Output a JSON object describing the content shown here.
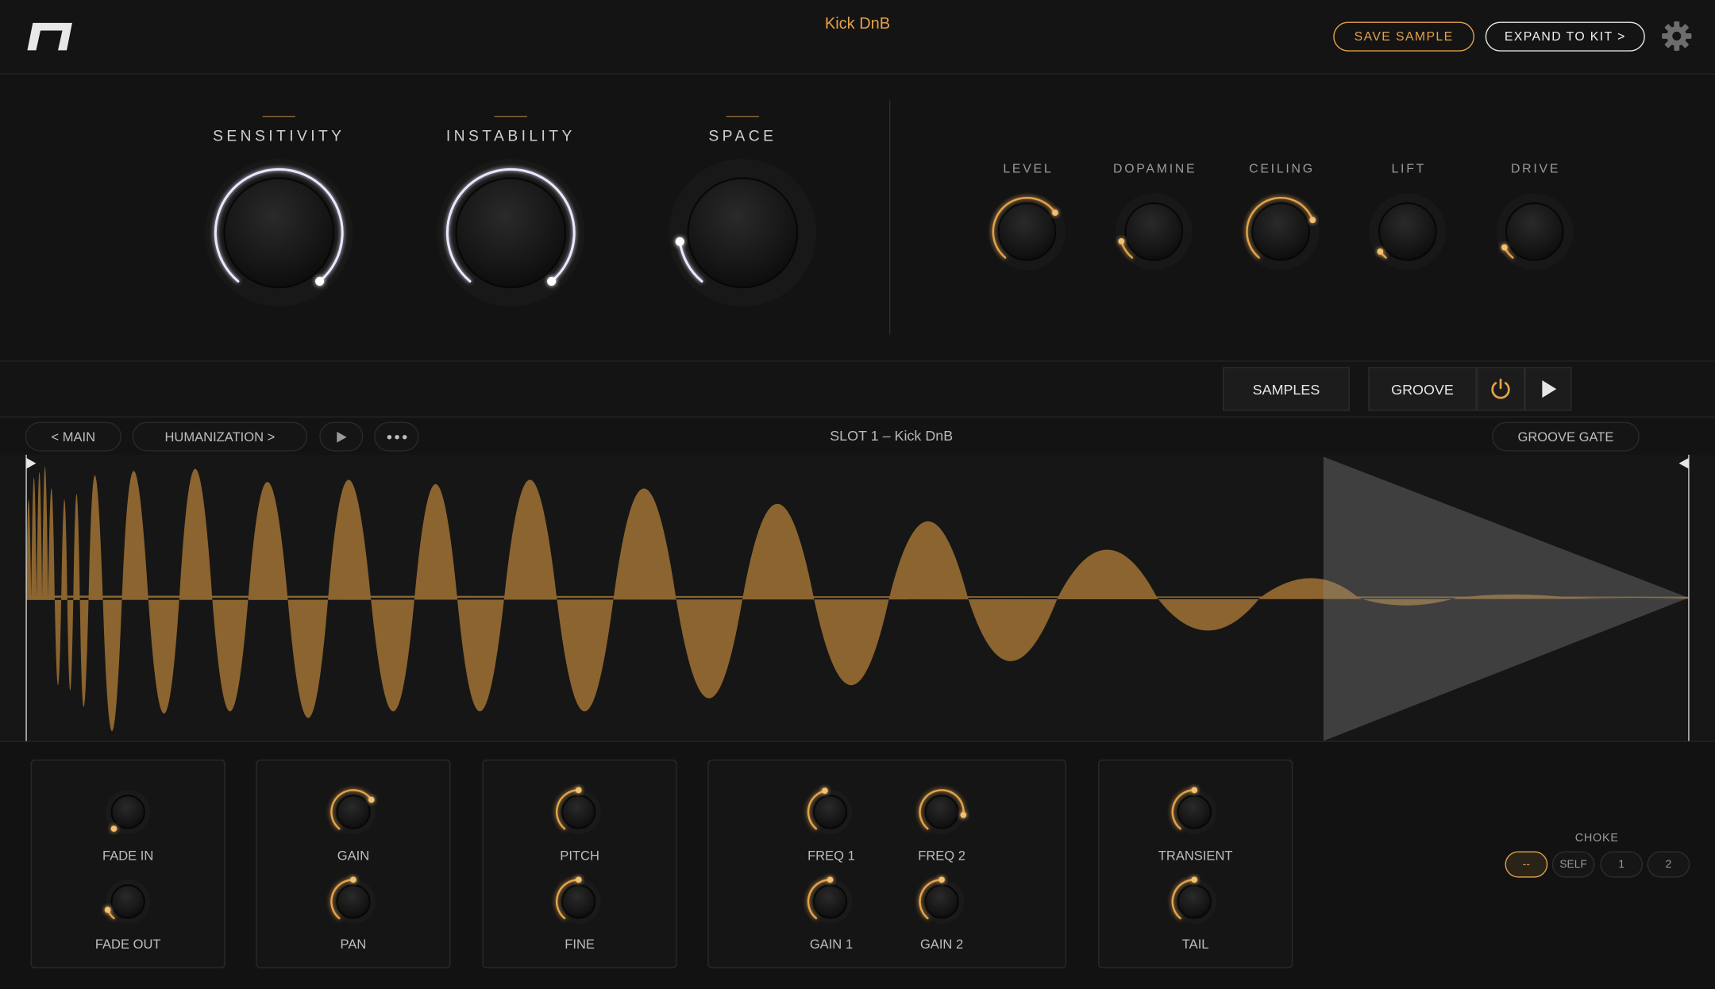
{
  "header": {
    "logo": "brand-logo",
    "title": "Kick DnB",
    "save_label": "SAVE SAMPLE",
    "expand_label": "EXPAND TO KIT >",
    "settings_icon": "gear-icon"
  },
  "macro_knobs": [
    {
      "label": "SENSITIVITY",
      "value": 1.0
    },
    {
      "label": "INSTABILITY",
      "value": 1.0
    },
    {
      "label": "SPACE",
      "value": 0.15
    }
  ],
  "fx_knobs": [
    {
      "label": "LEVEL",
      "value": 0.7
    },
    {
      "label": "DOPAMINE",
      "value": 0.12
    },
    {
      "label": "CEILING",
      "value": 0.75
    },
    {
      "label": "LIFT",
      "value": 0.05
    },
    {
      "label": "DRIVE",
      "value": 0.08
    }
  ],
  "transport": {
    "samples_label": "SAMPLES",
    "groove_label": "GROOVE",
    "power_icon": "power-icon",
    "play_icon": "play-icon"
  },
  "sample_bar": {
    "main_label": "< MAIN",
    "humanization_label": "HUMANIZATION >",
    "slot_label": "SLOT 1  –  Kick DnB",
    "groove_gate_label": "GROOVE GATE"
  },
  "colors": {
    "accent": "#e3a24a",
    "waveform": "#8b642f",
    "ring_white": "#e8e8ff"
  },
  "sample_panels": [
    {
      "knobs": [
        {
          "label": "FADE IN",
          "value": 0.0
        },
        {
          "label": "FADE OUT",
          "value": 0.1
        }
      ]
    },
    {
      "knobs": [
        {
          "label": "GAIN",
          "value": 0.7
        },
        {
          "label": "PAN",
          "value": 0.5
        }
      ]
    },
    {
      "knobs": [
        {
          "label": "PITCH",
          "value": 0.5
        },
        {
          "label": "FINE",
          "value": 0.5
        }
      ]
    },
    {
      "knobs": [
        {
          "label": "FREQ 1",
          "value": 0.45
        },
        {
          "label": "FREQ 2",
          "value": 0.85
        },
        {
          "label": "GAIN 1",
          "value": 0.5
        },
        {
          "label": "GAIN 2",
          "value": 0.5
        }
      ]
    },
    {
      "knobs": [
        {
          "label": "TRANSIENT",
          "value": 0.5
        },
        {
          "label": "TAIL",
          "value": 0.5
        }
      ]
    }
  ],
  "choke": {
    "title": "CHOKE",
    "options": [
      "--",
      "SELF",
      "1",
      "2"
    ],
    "selected": "--"
  }
}
